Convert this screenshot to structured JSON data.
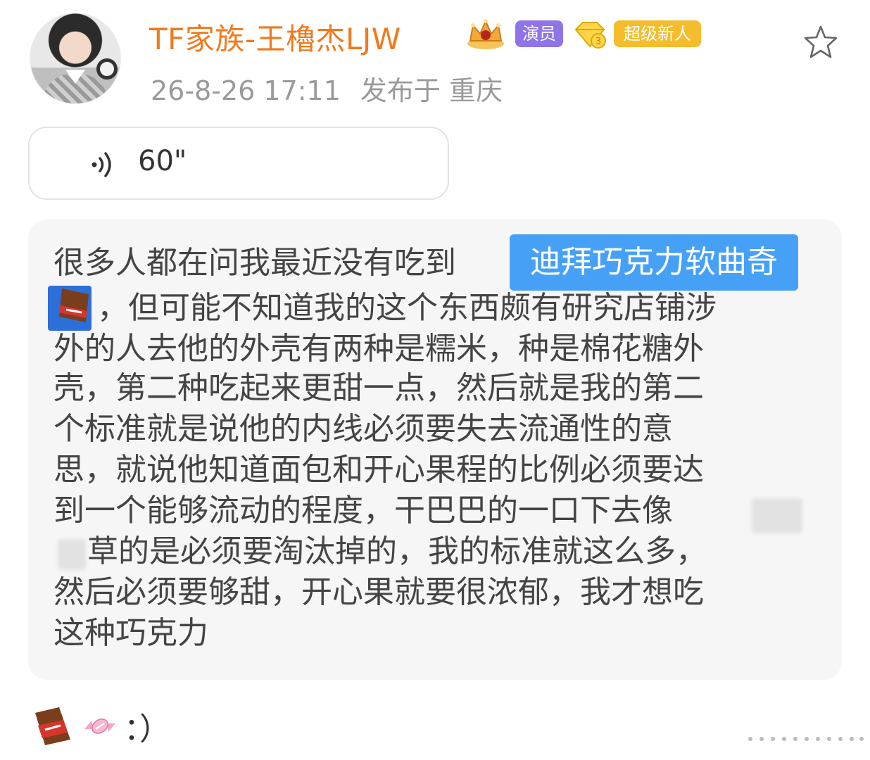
{
  "post": {
    "author": {
      "name": "TF家族-王櫓杰LJW",
      "tags": [
        {
          "label": "演员",
          "color": "#8f74e8"
        },
        {
          "label": "超级新人",
          "color": "#f5bd2b"
        }
      ]
    },
    "meta": {
      "date": "26-8-26 17:11",
      "location": "发布于 重庆"
    },
    "voice": {
      "duration": "60\""
    },
    "text": {
      "line1": "很多人都在问我最近没有吃到",
      "highlight": "迪拜巧克力软曲奇",
      "line2": "，但可能不知道我的这个东西颇有研究店铺涉",
      "line3": "外的人去他的外壳有两种是糯米，种是棉花糖外",
      "line4": "壳，第二种吃起来更甜一点，然后就是我的第二",
      "line5": "个标准就是说他的内线必须要失去流通性的意",
      "line6": "思，就说他知道面包和开心果程的比例必须要达",
      "line7": "到一个能够流动的程度，干巴巴的一口下去像",
      "line8": "草的是必须要淘汰掉的，我的标准就这么多，",
      "line9": "然后必须要够甜，开心果就要很浓郁，我才想吃",
      "line10": "这种巧克力"
    },
    "footer": {
      "text": "：）"
    }
  },
  "colors": {
    "username": "#f07a1d",
    "highlight": "#46a1f6",
    "meta": "#9a9a9a"
  }
}
